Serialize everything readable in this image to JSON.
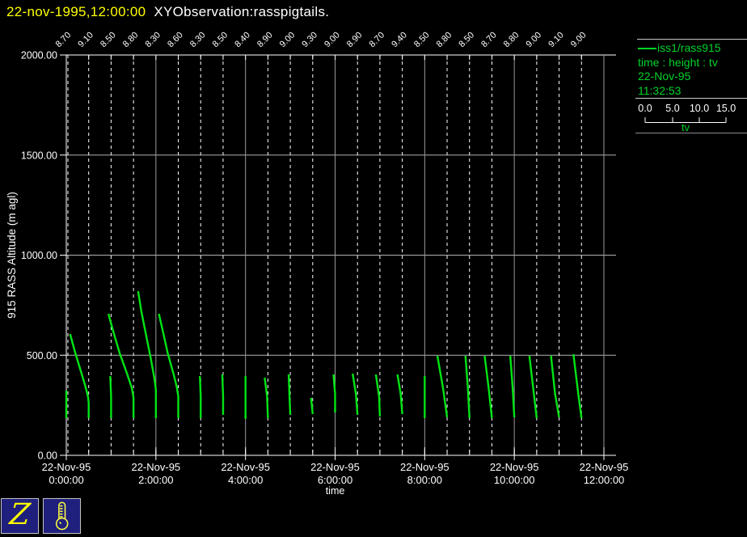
{
  "title": {
    "datetime": "22-nov-1995,12:00:00",
    "app": "XYObservation:rasspigtails."
  },
  "colors": {
    "yellow": "#ffff00",
    "green": "#00d42a",
    "curve": "#00e414",
    "grid": "#b2b2b2",
    "vgrid": "#9a9a9a",
    "navy": "#1f1f7d"
  },
  "legend": {
    "series": "iss1/rass915",
    "fields": "time : height : tv",
    "date": "22-Nov-95",
    "time": "11:32:53",
    "scale_ticks": [
      "0.0",
      "5.0",
      "10.0",
      "15.0"
    ],
    "scale_label": "tv"
  },
  "toolbar": {
    "zoom_glyph": "Z"
  },
  "chart_data": {
    "type": "line",
    "title": "XYObservation:rasspigtails.",
    "xlabel": "time",
    "ylabel": "915 RASS Altitude (m agl)",
    "ylim": [
      0,
      2000
    ],
    "yticks": [
      {
        "label": "0.00",
        "value": 0
      },
      {
        "label": "500.00",
        "value": 500
      },
      {
        "label": "1000.00",
        "value": 1000
      },
      {
        "label": "1500.00",
        "value": 1500
      },
      {
        "label": "2000.00",
        "value": 2000
      }
    ],
    "xticks": [
      {
        "date": "22-Nov-95",
        "time": "0:00:00",
        "hours": 0
      },
      {
        "date": "22-Nov-95",
        "time": "2:00:00",
        "hours": 2
      },
      {
        "date": "22-Nov-95",
        "time": "4:00:00",
        "hours": 4
      },
      {
        "date": "22-Nov-95",
        "time": "6:00:00",
        "hours": 6
      },
      {
        "date": "22-Nov-95",
        "time": "8:00:00",
        "hours": 8
      },
      {
        "date": "22-Nov-95",
        "time": "10:00:00",
        "hours": 10
      },
      {
        "date": "22-Nov-95",
        "time": "12:00:00",
        "hours": 12
      }
    ],
    "observations": [
      {
        "hours": 0,
        "tv": "8.70",
        "alt_top_m": 323,
        "alt_bottom_m": 185,
        "points": [
          [
            0,
            483
          ],
          [
            0,
            517
          ]
        ]
      },
      {
        "hours": 0.5,
        "tv": "9.10",
        "alt_top_m": 605,
        "alt_bottom_m": 185,
        "points": [
          [
            -23,
            413
          ],
          [
            -17,
            435
          ],
          [
            -10,
            458
          ],
          [
            -4,
            478
          ],
          [
            -1,
            490
          ],
          [
            0,
            498
          ],
          [
            0,
            517
          ]
        ]
      },
      {
        "hours": 1,
        "tv": "8.50",
        "alt_top_m": 395,
        "alt_bottom_m": 185,
        "points": [
          [
            -1,
            465
          ],
          [
            0,
            490
          ],
          [
            0,
            517
          ]
        ]
      },
      {
        "hours": 1.5,
        "tv": "8.80",
        "alt_top_m": 706,
        "alt_bottom_m": 185,
        "points": [
          [
            -31,
            388
          ],
          [
            -25,
            410
          ],
          [
            -17,
            437
          ],
          [
            -8,
            462
          ],
          [
            -2,
            480
          ],
          [
            0,
            492
          ],
          [
            0,
            517
          ]
        ]
      },
      {
        "hours": 2,
        "tv": "8.30",
        "alt_top_m": 819,
        "alt_bottom_m": 185,
        "points": [
          [
            -22,
            360
          ],
          [
            -18,
            385
          ],
          [
            -12,
            415
          ],
          [
            -6,
            445
          ],
          [
            -2,
            467
          ],
          [
            0,
            482
          ],
          [
            0,
            517
          ]
        ]
      },
      {
        "hours": 2.5,
        "tv": "8.60",
        "alt_top_m": 706,
        "alt_bottom_m": 185,
        "points": [
          [
            -24,
            388
          ],
          [
            -19,
            410
          ],
          [
            -13,
            437
          ],
          [
            -6,
            462
          ],
          [
            -2,
            478
          ],
          [
            0,
            490
          ],
          [
            0,
            517
          ]
        ]
      },
      {
        "hours": 3,
        "tv": "8.30",
        "alt_top_m": 395,
        "alt_bottom_m": 185,
        "points": [
          [
            -1,
            465
          ],
          [
            0,
            490
          ],
          [
            0,
            517
          ]
        ]
      },
      {
        "hours": 3.5,
        "tv": "8.50",
        "alt_top_m": 403,
        "alt_bottom_m": 202,
        "points": [
          [
            -1,
            463
          ],
          [
            0,
            490
          ],
          [
            0,
            513
          ]
        ]
      },
      {
        "hours": 4,
        "tv": "8.40",
        "alt_top_m": 395,
        "alt_bottom_m": 181,
        "points": [
          [
            0,
            465
          ],
          [
            0,
            518
          ]
        ]
      },
      {
        "hours": 4.5,
        "tv": "8.90",
        "alt_top_m": 387,
        "alt_bottom_m": 185,
        "points": [
          [
            -4,
            467
          ],
          [
            -1,
            490
          ],
          [
            0,
            517
          ]
        ]
      },
      {
        "hours": 5,
        "tv": "9.00",
        "alt_top_m": 403,
        "alt_bottom_m": 202,
        "points": [
          [
            -2,
            463
          ],
          [
            -1,
            490
          ],
          [
            0,
            513
          ]
        ]
      },
      {
        "hours": 5.5,
        "tv": "9.30",
        "alt_top_m": 286,
        "alt_bottom_m": 206,
        "points": [
          [
            -2,
            492
          ],
          [
            0,
            512
          ]
        ]
      },
      {
        "hours": 6,
        "tv": "9.00",
        "alt_top_m": 403,
        "alt_bottom_m": 214,
        "points": [
          [
            -2,
            463
          ],
          [
            0,
            487
          ],
          [
            0,
            510
          ]
        ]
      },
      {
        "hours": 6.5,
        "tv": "8.90",
        "alt_top_m": 407,
        "alt_bottom_m": 202,
        "points": [
          [
            -6,
            462
          ],
          [
            -2,
            487
          ],
          [
            0,
            513
          ]
        ]
      },
      {
        "hours": 7,
        "tv": "8.70",
        "alt_top_m": 403,
        "alt_bottom_m": 194,
        "points": [
          [
            -5,
            463
          ],
          [
            -1,
            490
          ],
          [
            0,
            515
          ]
        ]
      },
      {
        "hours": 7.5,
        "tv": "9.40",
        "alt_top_m": 403,
        "alt_bottom_m": 206,
        "points": [
          [
            -6,
            463
          ],
          [
            -2,
            487
          ],
          [
            0,
            512
          ]
        ]
      },
      {
        "hours": 8,
        "tv": "8.50",
        "alt_top_m": 395,
        "alt_bottom_m": 185,
        "points": [
          [
            0,
            465
          ],
          [
            0,
            517
          ]
        ]
      },
      {
        "hours": 8.5,
        "tv": "8.80",
        "alt_top_m": 496,
        "alt_bottom_m": 190,
        "points": [
          [
            -12,
            440
          ],
          [
            -5,
            480
          ],
          [
            0,
            516
          ]
        ]
      },
      {
        "hours": 9,
        "tv": "8.50",
        "alt_top_m": 496,
        "alt_bottom_m": 185,
        "points": [
          [
            -5,
            440
          ],
          [
            -2,
            480
          ],
          [
            0,
            517
          ]
        ]
      },
      {
        "hours": 9.5,
        "tv": "8.70",
        "alt_top_m": 496,
        "alt_bottom_m": 185,
        "points": [
          [
            -9,
            440
          ],
          [
            -4,
            480
          ],
          [
            0,
            517
          ]
        ]
      },
      {
        "hours": 10,
        "tv": "8.80",
        "alt_top_m": 496,
        "alt_bottom_m": 190,
        "points": [
          [
            -5,
            440
          ],
          [
            -2,
            480
          ],
          [
            0,
            516
          ]
        ]
      },
      {
        "hours": 10.5,
        "tv": "9.00",
        "alt_top_m": 496,
        "alt_bottom_m": 185,
        "points": [
          [
            -9,
            440
          ],
          [
            -4,
            483
          ],
          [
            0,
            517
          ]
        ]
      },
      {
        "hours": 11,
        "tv": "9.10",
        "alt_top_m": 496,
        "alt_bottom_m": 190,
        "points": [
          [
            -10,
            440
          ],
          [
            -5,
            487
          ],
          [
            0,
            516
          ]
        ]
      },
      {
        "hours": 11.5,
        "tv": "9.00",
        "alt_top_m": 504,
        "alt_bottom_m": 185,
        "points": [
          [
            -10,
            438
          ],
          [
            -4,
            487
          ],
          [
            0,
            517
          ]
        ]
      }
    ]
  }
}
